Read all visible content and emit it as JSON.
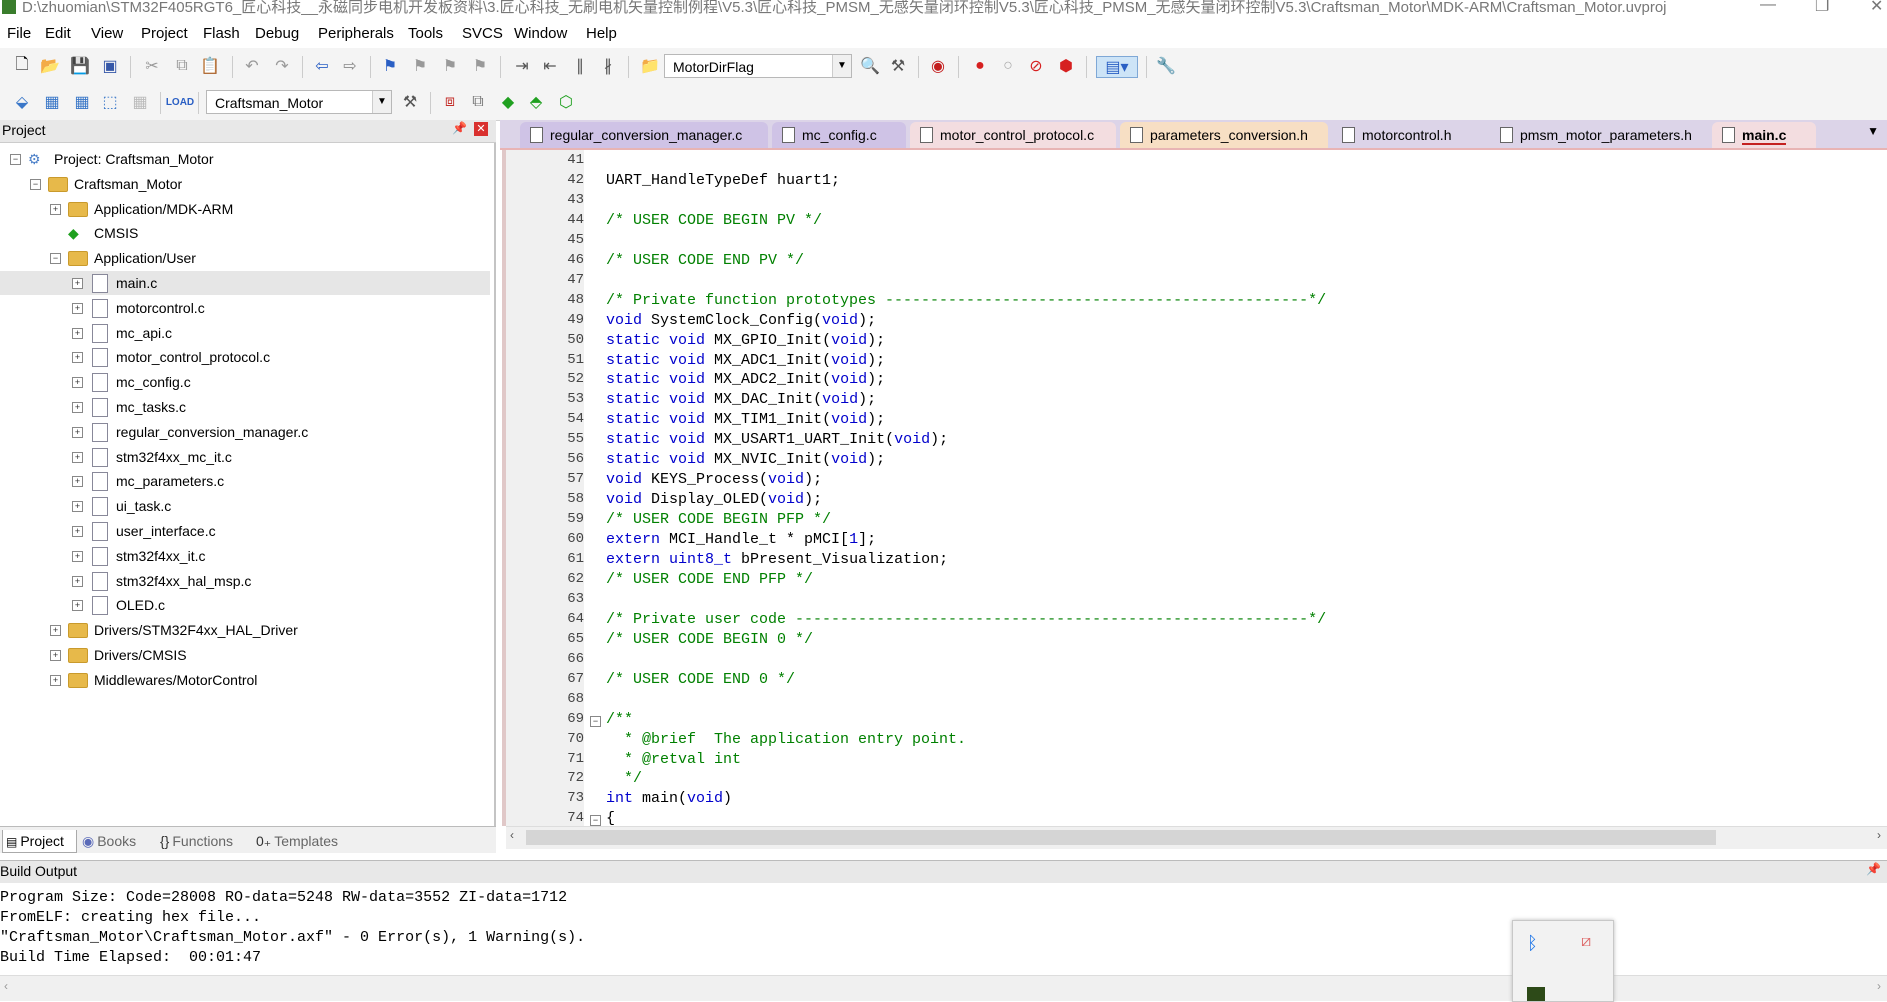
{
  "window": {
    "title": "D:\\zhuomian\\STM32F405RGT6_匠心科技__永磁同步电机开发板资料\\3.匠心科技_无刷电机矢量控制例程\\V5.3\\匠心科技_PMSM_无感矢量闭环控制V5.3\\匠心科技_PMSM_无感矢量闭环控制V5.3\\Craftsman_Motor\\MDK-ARM\\Craftsman_Motor.uvproj"
  },
  "menu": [
    "File",
    "Edit",
    "View",
    "Project",
    "Flash",
    "Debug",
    "Peripherals",
    "Tools",
    "SVCS",
    "Window",
    "Help"
  ],
  "toolbar": {
    "find_combo": "MotorDirFlag",
    "target_combo": "Craftsman_Motor"
  },
  "project_panel": {
    "title": "Project",
    "tree": [
      {
        "label": "Project: Craftsman_Motor",
        "level": 0,
        "kind": "project",
        "expanded": true
      },
      {
        "label": "Craftsman_Motor",
        "level": 1,
        "kind": "target",
        "expanded": true
      },
      {
        "label": "Application/MDK-ARM",
        "level": 2,
        "kind": "folder",
        "expanded": false
      },
      {
        "label": "CMSIS",
        "level": 2,
        "kind": "cmsis",
        "expanded": null
      },
      {
        "label": "Application/User",
        "level": 2,
        "kind": "folder-open",
        "expanded": true
      },
      {
        "label": "main.c",
        "level": 3,
        "kind": "file",
        "selected": true
      },
      {
        "label": "motorcontrol.c",
        "level": 3,
        "kind": "file"
      },
      {
        "label": "mc_api.c",
        "level": 3,
        "kind": "file"
      },
      {
        "label": "motor_control_protocol.c",
        "level": 3,
        "kind": "file"
      },
      {
        "label": "mc_config.c",
        "level": 3,
        "kind": "file"
      },
      {
        "label": "mc_tasks.c",
        "level": 3,
        "kind": "file"
      },
      {
        "label": "regular_conversion_manager.c",
        "level": 3,
        "kind": "file"
      },
      {
        "label": "stm32f4xx_mc_it.c",
        "level": 3,
        "kind": "file"
      },
      {
        "label": "mc_parameters.c",
        "level": 3,
        "kind": "file"
      },
      {
        "label": "ui_task.c",
        "level": 3,
        "kind": "file"
      },
      {
        "label": "user_interface.c",
        "level": 3,
        "kind": "file"
      },
      {
        "label": "stm32f4xx_it.c",
        "level": 3,
        "kind": "file"
      },
      {
        "label": "stm32f4xx_hal_msp.c",
        "level": 3,
        "kind": "file"
      },
      {
        "label": "OLED.c",
        "level": 3,
        "kind": "file"
      },
      {
        "label": "Drivers/STM32F4xx_HAL_Driver",
        "level": 2,
        "kind": "folder",
        "expanded": false
      },
      {
        "label": "Drivers/CMSIS",
        "level": 2,
        "kind": "folder",
        "expanded": false
      },
      {
        "label": "Middlewares/MotorControl",
        "level": 2,
        "kind": "folder",
        "expanded": false
      }
    ],
    "tabs": [
      "Project",
      "Books",
      "Functions",
      "Templates"
    ]
  },
  "editor_tabs": [
    {
      "label": "regular_conversion_manager.c",
      "color": "#cfc3e6"
    },
    {
      "label": "mc_config.c",
      "color": "#cfc3e6"
    },
    {
      "label": "motor_control_protocol.c",
      "color": "#f3dde0"
    },
    {
      "label": "parameters_conversion.h",
      "color": "#f7dfc4"
    },
    {
      "label": "motorcontrol.h",
      "color": "#dcd4e8"
    },
    {
      "label": "pmsm_motor_parameters.h",
      "color": "#dcd4e8"
    },
    {
      "label": "main.c",
      "color": "#f3dde0",
      "active": true
    }
  ],
  "code_lines": [
    {
      "n": "41",
      "t": "",
      "c": "plain"
    },
    {
      "n": "42",
      "t": "UART_HandleTypeDef huart1;",
      "c": "plain"
    },
    {
      "n": "43",
      "t": "",
      "c": "plain"
    },
    {
      "n": "44",
      "t": "/* USER CODE BEGIN PV */",
      "c": "cm"
    },
    {
      "n": "45",
      "t": "",
      "c": "plain"
    },
    {
      "n": "46",
      "t": "/* USER CODE END PV */",
      "c": "cm"
    },
    {
      "n": "47",
      "t": "",
      "c": "plain"
    },
    {
      "n": "48",
      "t": "/* Private function prototypes -----------------------------------------------*/",
      "c": "cm"
    },
    {
      "n": "49",
      "t": "void SystemClock_Config(void);",
      "c": "decl"
    },
    {
      "n": "50",
      "t": "static void MX_GPIO_Init(void);",
      "c": "decl"
    },
    {
      "n": "51",
      "t": "static void MX_ADC1_Init(void);",
      "c": "decl"
    },
    {
      "n": "52",
      "t": "static void MX_ADC2_Init(void);",
      "c": "decl"
    },
    {
      "n": "53",
      "t": "static void MX_DAC_Init(void);",
      "c": "decl"
    },
    {
      "n": "54",
      "t": "static void MX_TIM1_Init(void);",
      "c": "decl"
    },
    {
      "n": "55",
      "t": "static void MX_USART1_UART_Init(void);",
      "c": "decl"
    },
    {
      "n": "56",
      "t": "static void MX_NVIC_Init(void);",
      "c": "decl"
    },
    {
      "n": "57",
      "t": "void KEYS_Process(void);",
      "c": "decl"
    },
    {
      "n": "58",
      "t": "void Display_OLED(void);",
      "c": "decl"
    },
    {
      "n": "59",
      "t": "/* USER CODE BEGIN PFP */",
      "c": "cm"
    },
    {
      "n": "60",
      "t": "extern MCI_Handle_t * pMCI[1];",
      "c": "decl"
    },
    {
      "n": "61",
      "t": "extern uint8_t bPresent_Visualization;",
      "c": "decl"
    },
    {
      "n": "62",
      "t": "/* USER CODE END PFP */",
      "c": "cm"
    },
    {
      "n": "63",
      "t": "",
      "c": "plain"
    },
    {
      "n": "64",
      "t": "/* Private user code ---------------------------------------------------------*/",
      "c": "cm"
    },
    {
      "n": "65",
      "t": "/* USER CODE BEGIN 0 */",
      "c": "cm"
    },
    {
      "n": "66",
      "t": "",
      "c": "plain"
    },
    {
      "n": "67",
      "t": "/* USER CODE END 0 */",
      "c": "cm"
    },
    {
      "n": "68",
      "t": "",
      "c": "plain"
    },
    {
      "n": "69",
      "t": "/**",
      "c": "cm"
    },
    {
      "n": "70",
      "t": "  * @brief  The application entry point.",
      "c": "cm"
    },
    {
      "n": "71",
      "t": "  * @retval int",
      "c": "cm"
    },
    {
      "n": "72",
      "t": "  */",
      "c": "cm"
    },
    {
      "n": "73",
      "t": "int main(void)",
      "c": "decl"
    },
    {
      "n": "74",
      "t": "{",
      "c": "plain"
    }
  ],
  "build_output": {
    "title": "Build Output",
    "lines": [
      "Program Size: Code=28008 RO-data=5248 RW-data=3552 ZI-data=1712",
      "FromELF: creating hex file...",
      "\"Craftsman_Motor\\Craftsman_Motor.axf\" - 0 Error(s), 1 Warning(s).",
      "Build Time Elapsed:  00:01:47"
    ]
  }
}
